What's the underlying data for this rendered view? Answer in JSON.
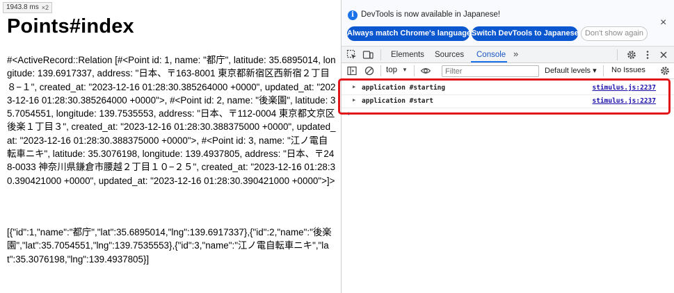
{
  "page": {
    "timing_value": "1943.8 ms",
    "timing_multiplier": "×2",
    "title": "Points#index",
    "relation_text": "#<ActiveRecord::Relation [#<Point id: 1, name: \"都庁\", latitude: 35.6895014, longitude: 139.6917337, address: \"日本、〒163-8001 東京都新宿区西新宿２丁目８−１\", created_at: \"2023-12-16 01:28:30.385264000 +0000\", updated_at: \"2023-12-16 01:28:30.385264000 +0000\">, #<Point id: 2, name: \"後楽園\", latitude: 35.7054551, longitude: 139.7535553, address: \"日本、〒112-0004 東京都文京区後楽１丁目３\", created_at: \"2023-12-16 01:28:30.388375000 +0000\", updated_at: \"2023-12-16 01:28:30.388375000 +0000\">, #<Point id: 3, name: \"江ノ電自転車ニキ\", latitude: 35.3076198, longitude: 139.4937805, address: \"日本、〒248-0033 神奈川県鎌倉市腰越２丁目１０−２５\", created_at: \"2023-12-16 01:28:30.390421000 +0000\", updated_at: \"2023-12-16 01:28:30.390421000 +0000\">]>",
    "json_text": "[{\"id\":1,\"name\":\"都庁\",\"lat\":35.6895014,\"lng\":139.6917337},{\"id\":2,\"name\":\"後楽園\",\"lat\":35.7054551,\"lng\":139.7535553},{\"id\":3,\"name\":\"江ノ電自転車ニキ\",\"lat\":35.3076198,\"lng\":139.4937805}]"
  },
  "devtools": {
    "banner": {
      "message": "DevTools is now available in Japanese!",
      "match_label": "Always match Chrome's language",
      "switch_label": "Switch DevTools to Japanese",
      "dont_show_label": "Don't show again",
      "close_glyph": "×"
    },
    "tabs": {
      "elements": "Elements",
      "sources": "Sources",
      "console": "Console",
      "more": "»"
    },
    "toolbar": {
      "context": "top",
      "filter_placeholder": "Filter",
      "levels": "Default levels ▾",
      "issues": "No Issues"
    },
    "logs": [
      {
        "message": "application #starting",
        "source": "stimulus.js:2237"
      },
      {
        "message": "application #start",
        "source": "stimulus.js:2237"
      }
    ],
    "prompt_glyph": "›"
  },
  "colors": {
    "accent_blue": "#0b57d0",
    "highlight_red": "#e1141a",
    "link": "#1a0dab"
  }
}
